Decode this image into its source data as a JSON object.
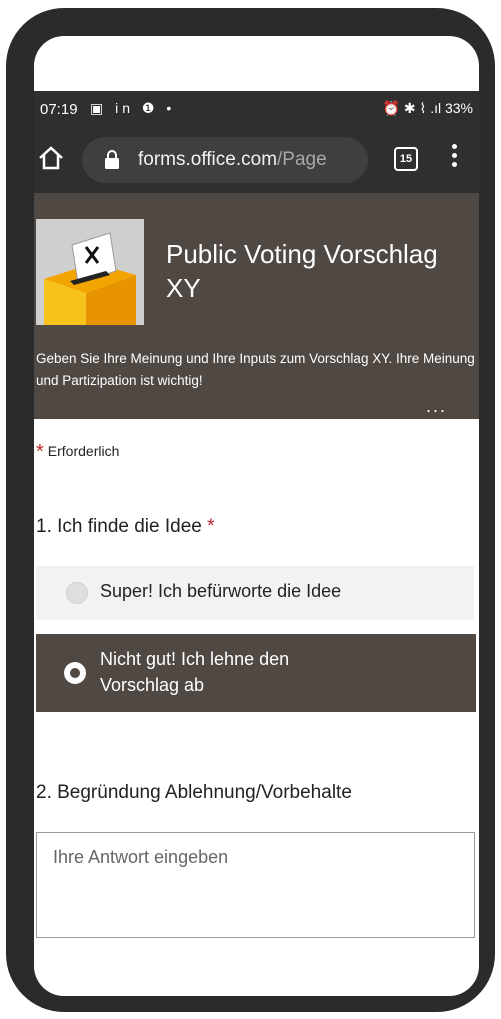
{
  "status_bar": {
    "time": "07:19",
    "left_icons": "▣ in ❶ •",
    "right_icons": "⏰ ✱ ⌇ .ıl 33%",
    "battery": "33%"
  },
  "browser": {
    "url_host": "forms.office.com",
    "url_path": "/Page",
    "tab_count": "15"
  },
  "form": {
    "title": "Public Voting Vorschlag XY",
    "description": "Geben Sie Ihre Meinung und Ihre Inputs zum Vorschlag XY. Ihre Meinung und Partizipation ist wichtig!",
    "more": "...",
    "required_star": "*",
    "required_label": "Erforderlich"
  },
  "question1": {
    "label": "1. Ich finde die Idee",
    "star": "*",
    "options": [
      {
        "label": "Super! Ich befürworte die Idee",
        "selected": false
      },
      {
        "label": "Nicht gut! Ich lehne den Vorschlag ab",
        "selected": true
      }
    ]
  },
  "question2": {
    "label": "2. Begründung Ablehnung/Vorbehalte",
    "placeholder": "Ihre Antwort eingeben"
  },
  "colors": {
    "header_bg": "#4f4843",
    "required_red": "#c0272d"
  }
}
